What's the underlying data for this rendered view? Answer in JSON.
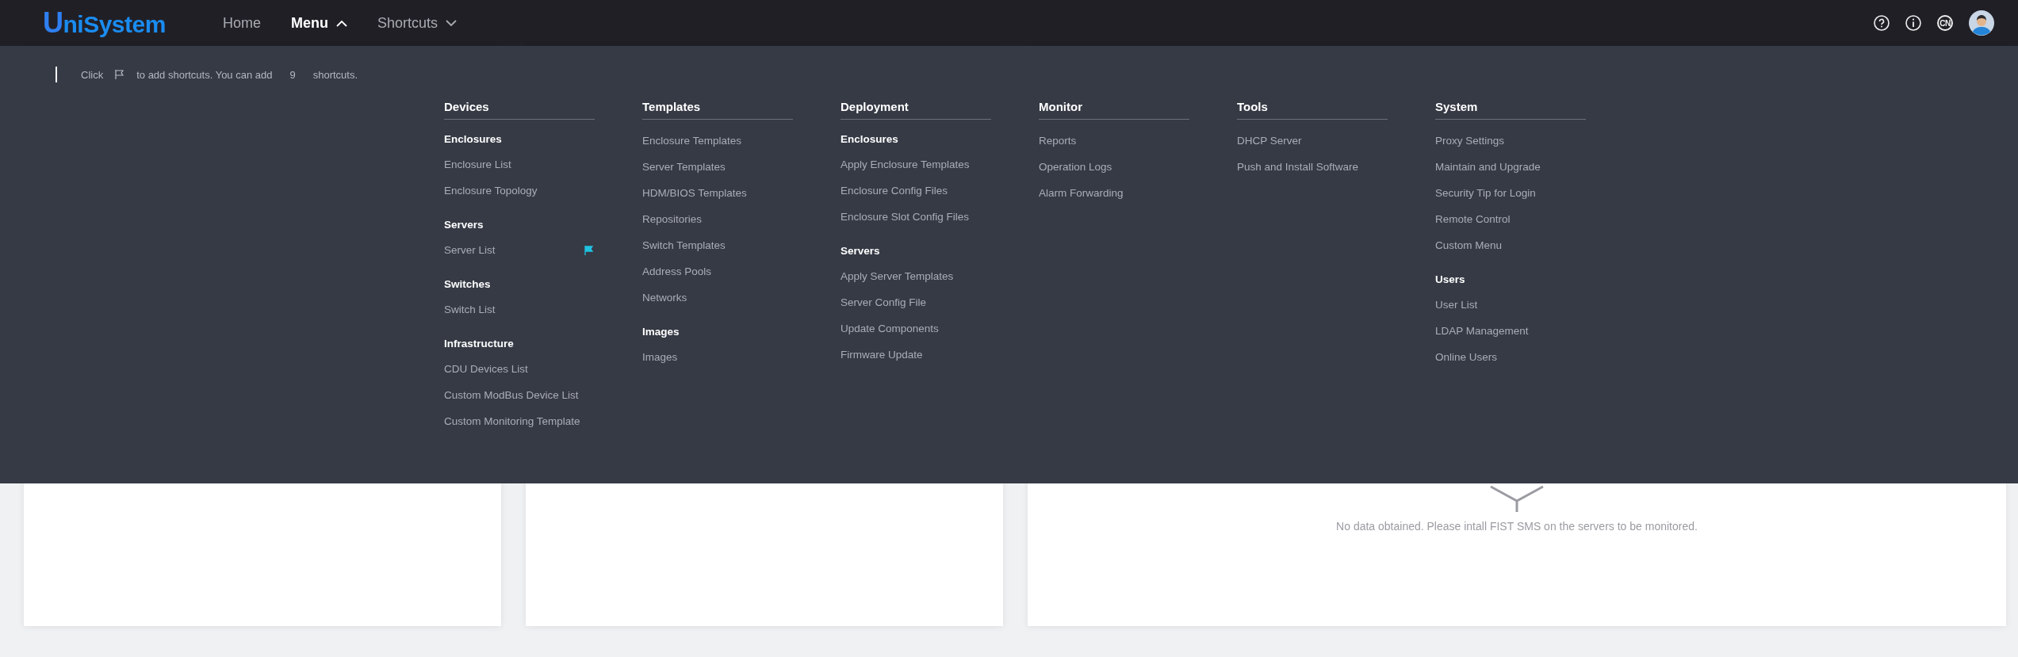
{
  "header": {
    "logo": "UniSystem",
    "nav": [
      {
        "label": "Home",
        "selected": false,
        "kind": "link"
      },
      {
        "label": "Menu",
        "selected": true,
        "kind": "dropdown",
        "expanded": true
      },
      {
        "label": "Shortcuts",
        "selected": false,
        "kind": "dropdown",
        "expanded": false
      }
    ],
    "language": "CN"
  },
  "shortcut_hint": {
    "before": "Click",
    "after": "to add shortcuts. You can add",
    "count": "9",
    "unit": "shortcuts."
  },
  "menu": {
    "columns": [
      {
        "title": "Devices",
        "groups": [
          {
            "heading": "Enclosures",
            "items": [
              {
                "label": "Enclosure List",
                "pinned": false
              },
              {
                "label": "Enclosure Topology",
                "pinned": false
              }
            ]
          },
          {
            "heading": "Servers",
            "items": [
              {
                "label": "Server List",
                "pinned": true
              }
            ]
          },
          {
            "heading": "Switches",
            "items": [
              {
                "label": "Switch List",
                "pinned": false
              }
            ]
          },
          {
            "heading": "Infrastructure",
            "items": [
              {
                "label": "CDU Devices List",
                "pinned": false
              },
              {
                "label": "Custom ModBus Device List",
                "pinned": false
              },
              {
                "label": "Custom Monitoring Template",
                "pinned": false
              }
            ]
          }
        ]
      },
      {
        "title": "Templates",
        "groups": [
          {
            "items": [
              {
                "label": "Enclosure Templates",
                "pinned": false
              },
              {
                "label": "Server Templates",
                "pinned": false
              },
              {
                "label": "HDM/BIOS Templates",
                "pinned": false
              },
              {
                "label": "Repositories",
                "pinned": false
              },
              {
                "label": "Switch Templates",
                "pinned": false
              },
              {
                "label": "Address Pools",
                "pinned": false
              },
              {
                "label": "Networks",
                "pinned": false
              }
            ]
          },
          {
            "heading": "Images",
            "items": [
              {
                "label": "Images",
                "pinned": false
              }
            ]
          }
        ]
      },
      {
        "title": "Deployment",
        "groups": [
          {
            "heading": "Enclosures",
            "items": [
              {
                "label": "Apply Enclosure Templates",
                "pinned": false
              },
              {
                "label": "Enclosure Config Files",
                "pinned": false
              },
              {
                "label": "Enclosure Slot Config Files",
                "pinned": false
              }
            ]
          },
          {
            "heading": "Servers",
            "items": [
              {
                "label": "Apply Server Templates",
                "pinned": false
              },
              {
                "label": "Server Config File",
                "pinned": false
              },
              {
                "label": "Update Components",
                "pinned": false
              },
              {
                "label": "Firmware Update",
                "pinned": false
              }
            ]
          }
        ]
      },
      {
        "title": "Monitor",
        "groups": [
          {
            "items": [
              {
                "label": "Reports",
                "pinned": false
              },
              {
                "label": "Operation Logs",
                "pinned": false
              },
              {
                "label": "Alarm Forwarding",
                "pinned": false
              }
            ]
          }
        ]
      },
      {
        "title": "Tools",
        "groups": [
          {
            "items": [
              {
                "label": "DHCP Server",
                "pinned": false
              },
              {
                "label": "Push and Install Software",
                "pinned": false
              }
            ]
          }
        ]
      },
      {
        "title": "System",
        "groups": [
          {
            "items": [
              {
                "label": "Proxy Settings",
                "pinned": false
              },
              {
                "label": "Maintain and Upgrade",
                "pinned": false
              },
              {
                "label": "Security Tip for Login",
                "pinned": false
              },
              {
                "label": "Remote Control",
                "pinned": false
              },
              {
                "label": "Custom Menu",
                "pinned": false
              }
            ]
          },
          {
            "heading": "Users",
            "items": [
              {
                "label": "User List",
                "pinned": false
              },
              {
                "label": "LDAP Management",
                "pinned": false
              },
              {
                "label": "Online Users",
                "pinned": false
              }
            ]
          }
        ]
      }
    ]
  },
  "cards": [
    {
      "kind": "blank"
    },
    {
      "kind": "blank"
    },
    {
      "kind": "empty",
      "message": "No data obtained. Please intall FIST SMS on the servers to be monitored."
    }
  ]
}
